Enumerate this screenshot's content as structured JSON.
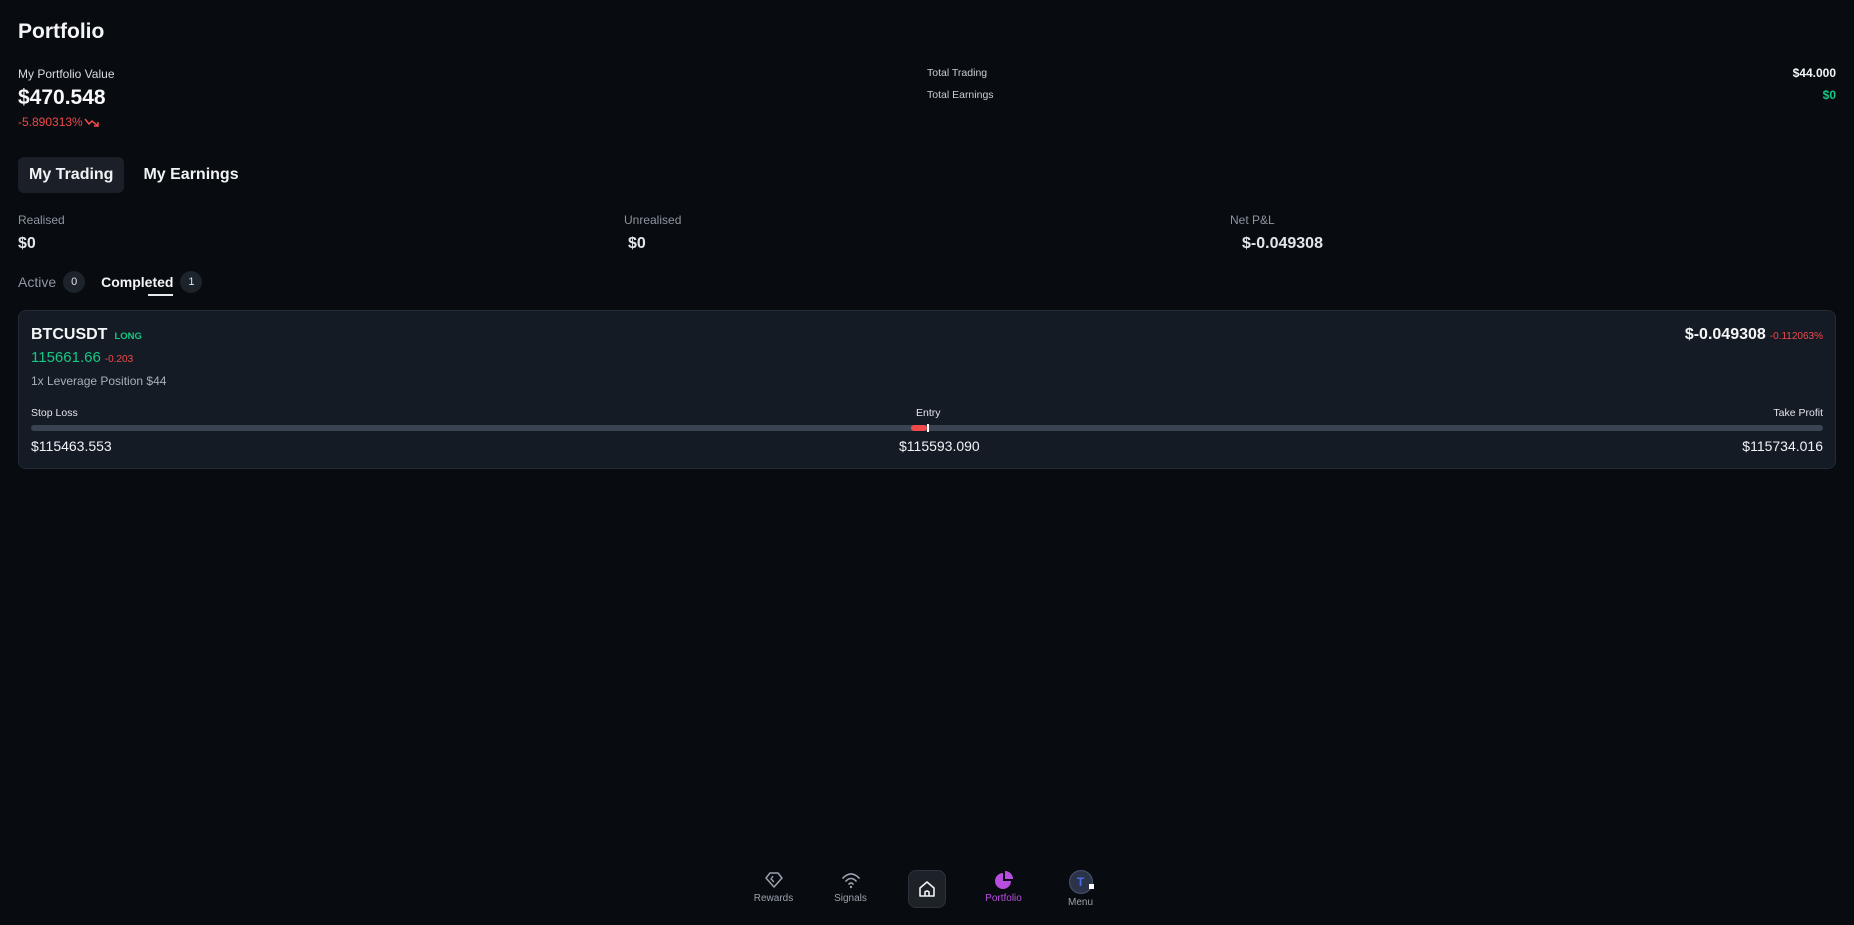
{
  "header": {
    "title": "Portfolio"
  },
  "portfolio": {
    "value_label": "My Portfolio Value",
    "value": "$470.548",
    "change": "-5.890313%"
  },
  "totals": {
    "trading_label": "Total Trading",
    "trading_value": "$44.000",
    "earnings_label": "Total Earnings",
    "earnings_value": "$0"
  },
  "main_tabs": [
    {
      "label": "My Trading",
      "active": true
    },
    {
      "label": "My Earnings",
      "active": false
    }
  ],
  "pnl": {
    "realised_label": "Realised",
    "realised_value": "$0",
    "unrealised_label": "Unrealised",
    "unrealised_value": "$0",
    "net_label": "Net P&L",
    "net_value": "$-0.049308"
  },
  "sub_tabs": [
    {
      "label": "Active",
      "count": "0",
      "active": false
    },
    {
      "label": "Completed",
      "count": "1",
      "active": true
    }
  ],
  "position": {
    "symbol": "BTCUSDT",
    "side": "LONG",
    "price": "115661.66",
    "price_change": "-0.203",
    "description": "1x Leverage Position $44",
    "pnl": "$-0.049308",
    "pnl_pct": "-0.112063%",
    "stop_loss_label": "Stop Loss",
    "entry_label": "Entry",
    "take_profit_label": "Take Profit",
    "stop_loss": "$115463.553",
    "entry": "$115593.090",
    "take_profit": "$115734.016",
    "range_fill_start": 0.491,
    "range_fill_end": 0.5,
    "range_marker": 0.5
  },
  "nav": {
    "rewards": "Rewards",
    "signals": "Signals",
    "portfolio": "Portfolio",
    "menu": "Menu"
  },
  "colors": {
    "positive": "#16c784",
    "negative": "#f04a4a",
    "active_nav": "#b84ee0"
  },
  "icons": [
    "trend-down-icon",
    "diamond-icon",
    "wifi-signal-icon",
    "home-icon",
    "pie-chart-icon",
    "avatar-icon"
  ]
}
